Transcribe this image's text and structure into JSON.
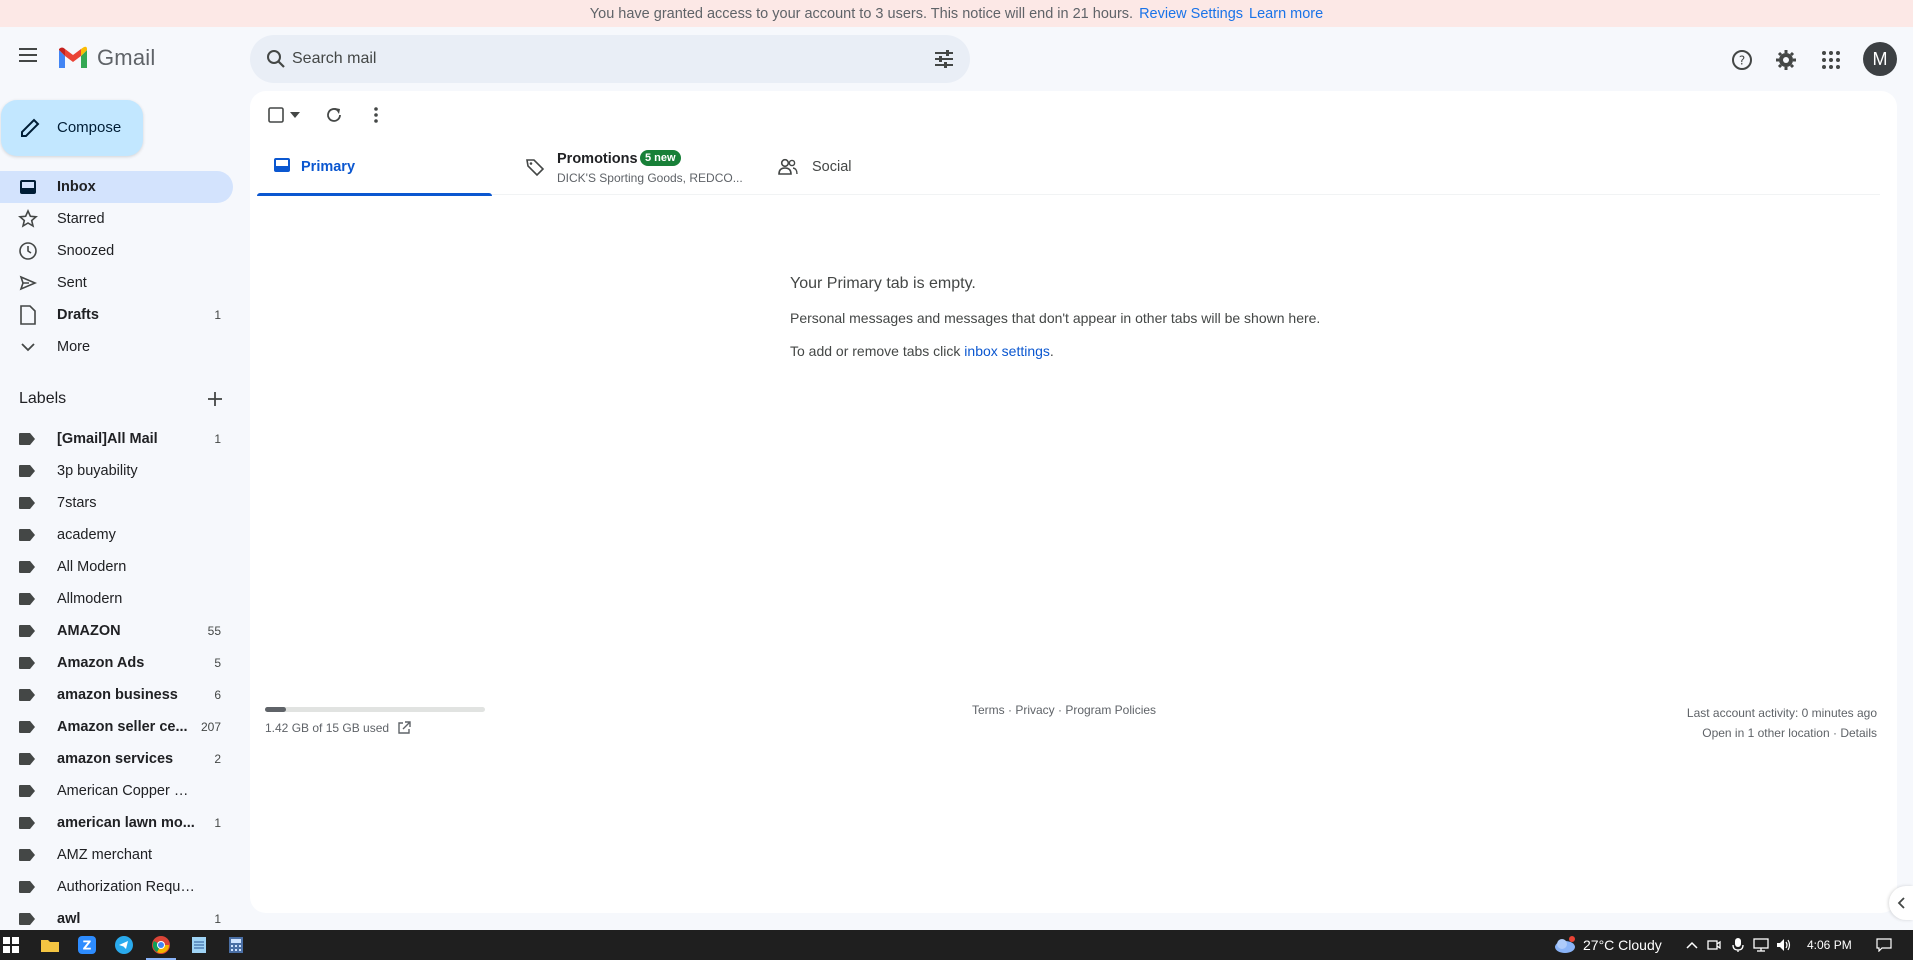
{
  "notice": {
    "text": "You have granted access to your account to 3 users. This notice will end in 21 hours.",
    "review_link": "Review Settings",
    "learn_link": "Learn more"
  },
  "header": {
    "app_name": "Gmail",
    "search_placeholder": "Search mail",
    "avatar_letter": "M"
  },
  "sidebar": {
    "compose_label": "Compose",
    "nav": [
      {
        "label": "Inbox",
        "count": "",
        "icon": "inbox-icon"
      },
      {
        "label": "Starred",
        "count": "",
        "icon": "star-icon"
      },
      {
        "label": "Snoozed",
        "count": "",
        "icon": "clock-icon"
      },
      {
        "label": "Sent",
        "count": "",
        "icon": "send-icon"
      },
      {
        "label": "Drafts",
        "count": "1",
        "icon": "draft-icon"
      },
      {
        "label": "More",
        "count": "",
        "icon": "chevron-down-icon"
      }
    ],
    "labels_heading": "Labels",
    "labels": [
      {
        "name": "[Gmail]All Mail",
        "count": "1"
      },
      {
        "name": "3p buyability",
        "count": ""
      },
      {
        "name": "7stars",
        "count": ""
      },
      {
        "name": "academy",
        "count": ""
      },
      {
        "name": "All Modern",
        "count": ""
      },
      {
        "name": "Allmodern",
        "count": ""
      },
      {
        "name": "AMAZON",
        "count": "55"
      },
      {
        "name": "Amazon Ads",
        "count": "5"
      },
      {
        "name": "amazon business",
        "count": "6"
      },
      {
        "name": "Amazon seller ce...",
        "count": "207"
      },
      {
        "name": "amazon services",
        "count": "2"
      },
      {
        "name": "American Copper Brass",
        "count": ""
      },
      {
        "name": "american lawn mo...",
        "count": "1"
      },
      {
        "name": "AMZ merchant",
        "count": ""
      },
      {
        "name": "Authorization Request",
        "count": ""
      },
      {
        "name": "awl",
        "count": "1"
      }
    ]
  },
  "tabs": {
    "primary": "Primary",
    "promotions": "Promotions",
    "promotions_badge": "5 new",
    "promotions_sub": "DICK'S Sporting Goods, REDCO...",
    "social": "Social"
  },
  "empty_state": {
    "title": "Your Primary tab is empty.",
    "line1": "Personal messages and messages that don't appear in other tabs will be shown here.",
    "line2_prefix": "To add or remove tabs click ",
    "line2_link": "inbox settings",
    "line2_suffix": "."
  },
  "footer": {
    "storage_text": "1.42 GB of 15 GB used",
    "storage_fraction": 0.095,
    "links": "Terms · Privacy · Program Policies",
    "last_activity": "Last account activity: 0 minutes ago",
    "open_location": "Open in 1 other location · Details"
  },
  "taskbar": {
    "weather": "27°C  Cloudy",
    "time": "4:06 PM"
  },
  "colors": {
    "accent": "#0b57d0",
    "compose_bg": "#c2e7ff",
    "active_nav": "#d3e3fd",
    "badge_green": "#188038",
    "notice_bg": "#fce8e6"
  }
}
